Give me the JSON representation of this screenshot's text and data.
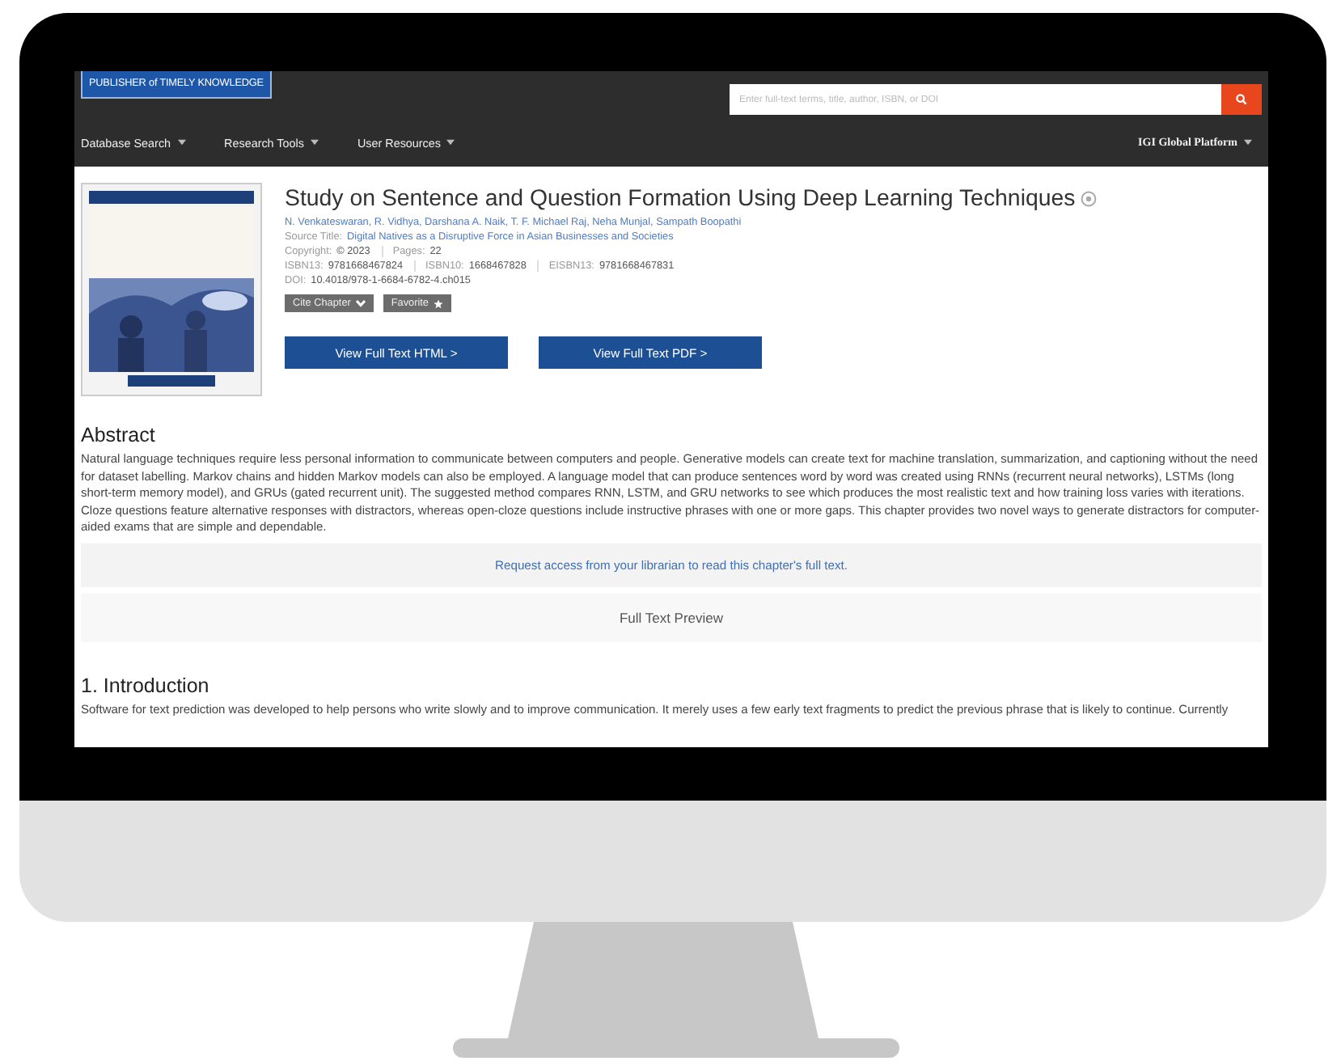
{
  "header": {
    "logo": "PUBLISHER of TIMELY KNOWLEDGE",
    "search": {
      "placeholder": "Enter full-text terms, title, author, ISBN, or DOI"
    },
    "nav": [
      {
        "label": "Database Search"
      },
      {
        "label": "Research Tools"
      },
      {
        "label": "User Resources"
      }
    ],
    "platform": "IGI Global Platform"
  },
  "chapter": {
    "cover": {
      "kind": "picture"
    },
    "title": "Study on Sentence and Question Formation Using Deep Learning Techniques",
    "authors": "N. Venkateswaran, R. Vidhya, Darshana A. Naik, T. F. Michael Raj, Neha Munjal, Sampath Boopathi",
    "source": {
      "label": "Source Title:",
      "value": "Digital Natives as a Disruptive Force in Asian Businesses and Societies"
    },
    "meta": [
      {
        "label": "Copyright:",
        "value": "© 2023"
      },
      {
        "label": "Pages:",
        "value": "22"
      }
    ],
    "isbns": [
      {
        "label": "ISBN13:",
        "value": "9781668467824"
      },
      {
        "label": "ISBN10:",
        "value": "1668467828"
      },
      {
        "label": "EISBN13:",
        "value": "9781668467831"
      }
    ],
    "doi": {
      "label": "DOI:",
      "value": "10.4018/978-1-6684-6782-4.ch015"
    },
    "small_buttons": [
      {
        "label": "Cite Chapter",
        "kind": "dropdown"
      },
      {
        "label": "Favorite",
        "kind": "star"
      }
    ],
    "buttons": [
      "View Full Text HTML >",
      "View Full Text PDF >"
    ]
  },
  "abstract": {
    "heading": "Abstract",
    "text": "Natural language techniques require less personal information to communicate between computers and people. Generative models can create text for machine translation, summarization, and captioning without the need for dataset labelling. Markov chains and hidden Markov models can also be employed. A language model that can produce sentences word by word was created using RNNs (recurrent neural networks), LSTMs (long short-term memory model), and GRUs (gated recurrent unit). The suggested method compares RNN, LSTM, and GRU networks to see which produces the most realistic text and how training loss varies with iterations. Cloze questions feature alternative responses with distractors, whereas open-cloze questions include instructive phrases with one or more gaps. This chapter provides two novel ways to generate distractors for computer-aided exams that are simple and dependable."
  },
  "access_link": "Request access from your librarian to read this chapter's full text.",
  "preview": "Full Text Preview",
  "introduction": {
    "heading": "1. Introduction",
    "text": "Software for text prediction was developed to help persons who write slowly and to improve communication. It merely uses a few early text fragments to predict the previous phrase that is likely to continue. Currently"
  }
}
